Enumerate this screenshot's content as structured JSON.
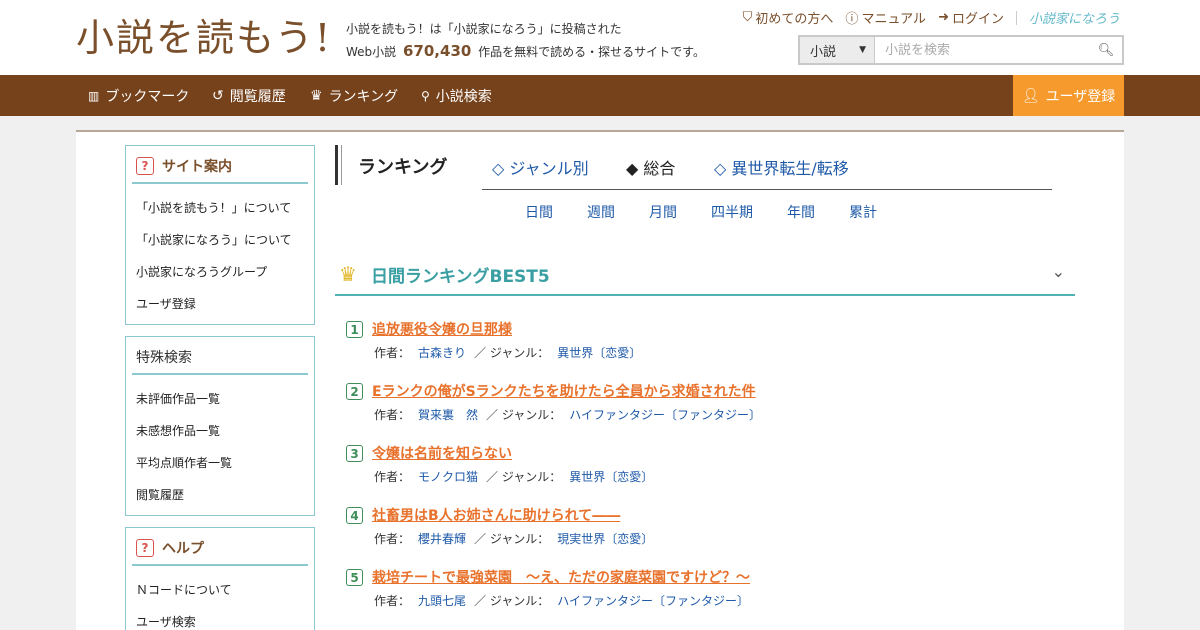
{
  "header": {
    "logo": "小説を読もう!",
    "tagline_line1": "小説を読もう！は「小説家になろう」に投稿された",
    "tagline_prefix": "Web小説",
    "tagline_count": "670,430",
    "tagline_suffix": "作品を無料で読める・探せるサイトです。",
    "links": {
      "first_time": "初めての方へ",
      "manual": "マニュアル",
      "login": "ログイン",
      "narou": "小説家になろう"
    },
    "search": {
      "category": "小説",
      "placeholder": "小説を検索"
    }
  },
  "nav": {
    "bookmark": "ブックマーク",
    "history": "閲覧履歴",
    "ranking": "ランキング",
    "search": "小説検索",
    "register": "ユーザ登録"
  },
  "sidebar": {
    "site_guide": {
      "title": "サイト案内",
      "items": [
        "「小説を読もう！」について",
        "「小説家になろう」について",
        "小説家になろうグループ",
        "ユーザ登録"
      ]
    },
    "special_search": {
      "title": "特殊検索",
      "items": [
        "未評価作品一覧",
        "未感想作品一覧",
        "平均点順作者一覧",
        "閲覧履歴"
      ]
    },
    "help": {
      "title": "ヘルプ",
      "items": [
        "Ｎコードについて",
        "ユーザ検索"
      ]
    }
  },
  "ranking": {
    "title": "ランキング",
    "tabs": [
      "◇ ジャンル別",
      "◆ 総合",
      "◇ 異世界転生/転移"
    ],
    "periods": [
      "日間",
      "週間",
      "月間",
      "四半期",
      "年間",
      "累計"
    ],
    "best_title": "日間ランキングBEST5",
    "author_label": "作者：",
    "genre_label": "／ ジャンル：",
    "entries": [
      {
        "rank": "1",
        "title": "追放悪役令嬢の旦那様",
        "author": "古森きり",
        "genre": "異世界〔恋愛〕"
      },
      {
        "rank": "2",
        "title": "Eランクの俺がSランクたちを助けたら全員から求婚された件",
        "author": "賀来裏　然",
        "genre": "ハイファンタジー〔ファンタジー〕"
      },
      {
        "rank": "3",
        "title": "令嬢は名前を知らない",
        "author": "モノクロ猫",
        "genre": "異世界〔恋愛〕"
      },
      {
        "rank": "4",
        "title": "社畜男はB人お姉さんに助けられて――",
        "author": "櫻井春輝",
        "genre": "現実世界〔恋愛〕"
      },
      {
        "rank": "5",
        "title": "栽培チートで最強菜園　～え、ただの家庭菜園ですけど？～",
        "author": "九頭七尾",
        "genre": "ハイファンタジー〔ファンタジー〕"
      }
    ]
  },
  "colors": {
    "brand_brown": "#75421c",
    "register_orange": "#f79a2d",
    "accent_teal": "#4fb3b3",
    "title_orange": "#e8722c",
    "link_blue": "#1f5aa8"
  }
}
